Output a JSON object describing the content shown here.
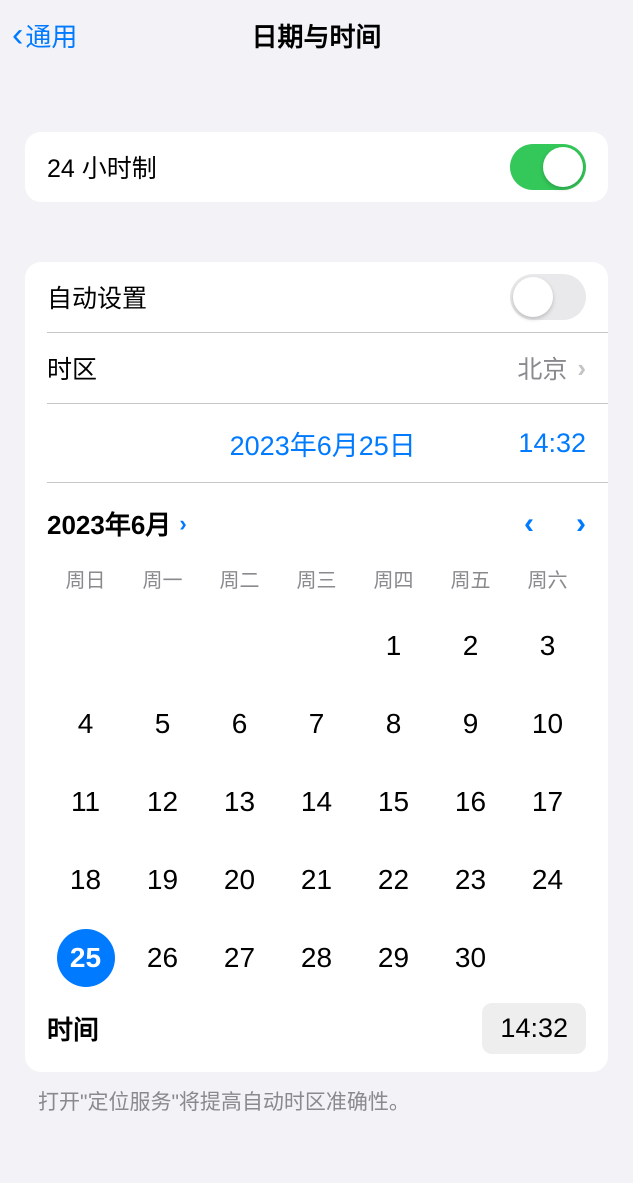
{
  "nav": {
    "back_label": "通用",
    "title": "日期与时间"
  },
  "clock24h": {
    "label": "24 小时制",
    "enabled": true
  },
  "auto_set": {
    "label": "自动设置",
    "enabled": false
  },
  "timezone": {
    "label": "时区",
    "value": "北京"
  },
  "current": {
    "date_display": "2023年6月25日",
    "time_display": "14:32"
  },
  "calendar": {
    "month_label": "2023年6月",
    "weekdays": [
      "周日",
      "周一",
      "周二",
      "周三",
      "周四",
      "周五",
      "周六"
    ],
    "leading_blanks": 4,
    "days_in_month": 30,
    "selected_day": 25
  },
  "time_row": {
    "label": "时间",
    "value": "14:32"
  },
  "footer": "打开\"定位服务\"将提高自动时区准确性。"
}
